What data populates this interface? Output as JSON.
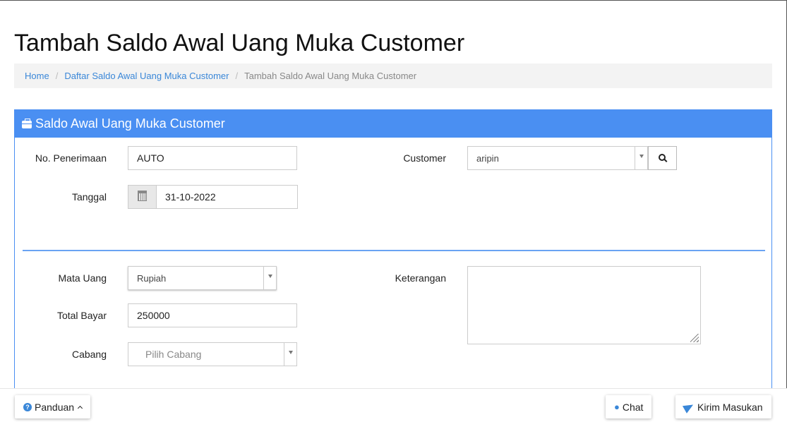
{
  "page": {
    "title": "Tambah Saldo Awal Uang Muka Customer"
  },
  "breadcrumb": {
    "items": [
      "Home",
      "Daftar Saldo Awal Uang Muka Customer"
    ],
    "active": "Tambah Saldo Awal Uang Muka Customer",
    "separator": "/"
  },
  "panel": {
    "title": "Saldo Awal Uang Muka Customer",
    "icon": "briefcase-icon",
    "color": "#4a8ff2"
  },
  "form": {
    "no_penerimaan": {
      "label": "No. Penerimaan",
      "value": "AUTO"
    },
    "tanggal": {
      "label": "Tanggal",
      "value": "31-10-2022",
      "icon": "calendar-icon"
    },
    "customer": {
      "label": "Customer",
      "value": "aripin",
      "search_icon": "search-icon"
    },
    "mata_uang": {
      "label": "Mata Uang",
      "value": "Rupiah"
    },
    "total_bayar": {
      "label": "Total Bayar",
      "value": "250000"
    },
    "cabang": {
      "label": "Cabang",
      "placeholder": "Pilih Cabang"
    },
    "keterangan": {
      "label": "Keterangan",
      "value": ""
    }
  },
  "footer": {
    "panduan_label": "Panduan",
    "chat_label": "Chat",
    "kirim_label": "Kirim Masukan"
  }
}
